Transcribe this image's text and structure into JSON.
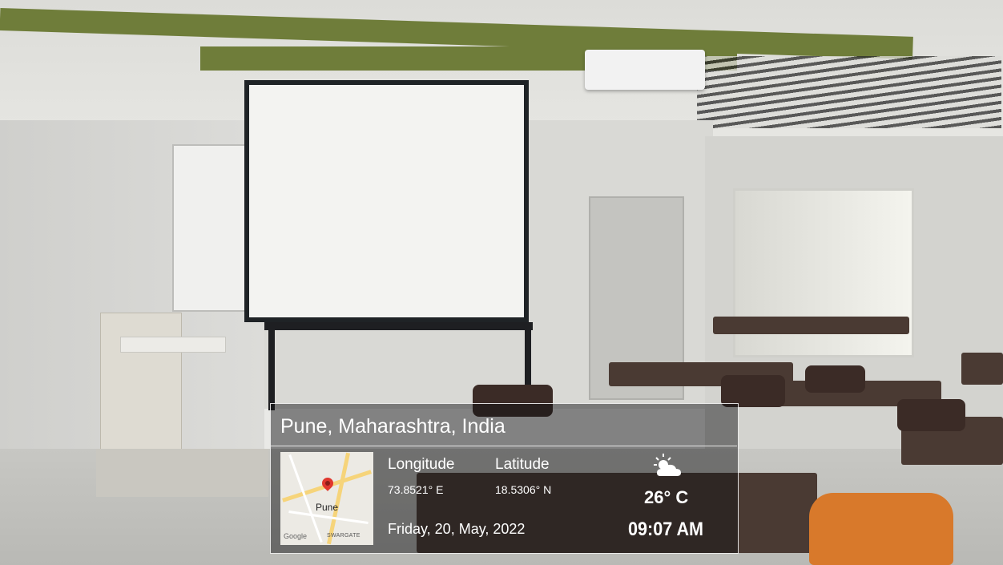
{
  "location": {
    "title": "Pune, Maharashtra, India",
    "map": {
      "city_label": "Pune",
      "attribution": "Google",
      "area_label": "SWARGATE"
    },
    "longitude": {
      "label": "Longitude",
      "value": "73.8521° E"
    },
    "latitude": {
      "label": "Latitude",
      "value": "18.5306° N"
    },
    "date": "Friday, 20, May, 2022"
  },
  "weather": {
    "icon": "partly-cloudy-icon",
    "temperature": "26° C",
    "time": "09:07 AM"
  },
  "colors": {
    "card_border": "#ffffff",
    "card_text": "#ffffff",
    "map_pin": "#e0372d",
    "beam": "#6f7d3a"
  }
}
